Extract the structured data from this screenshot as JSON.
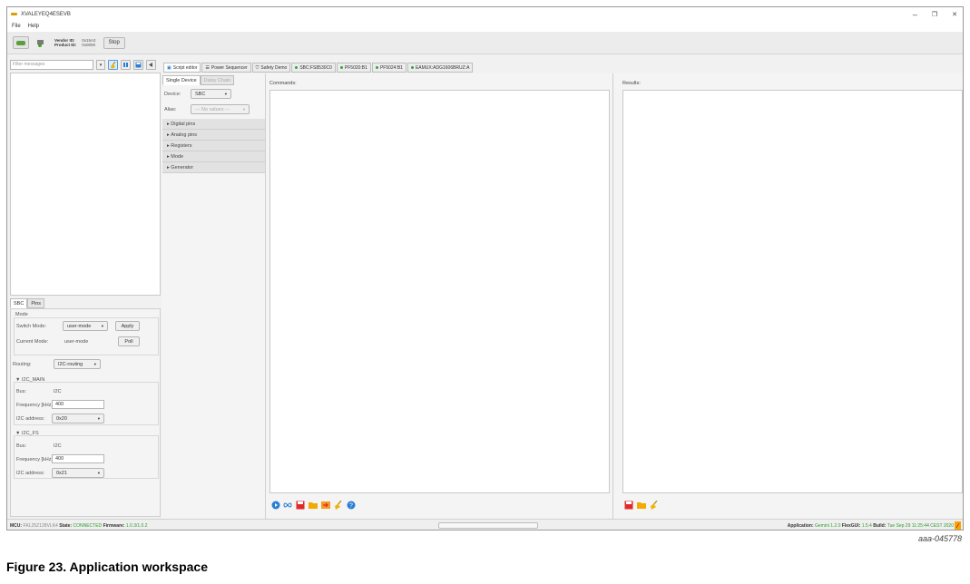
{
  "window": {
    "title": "XVALEYEQ4ESEVB",
    "controls": [
      "–",
      "❐",
      "✕"
    ]
  },
  "menu": [
    "File",
    "Help"
  ],
  "toolbar": {
    "vendor_label": "Vendor ID:",
    "vendor_value": "0x15A2",
    "product_label": "Product ID:",
    "product_value": "0x0000",
    "stop_label": "Stop"
  },
  "filter": {
    "placeholder": "Filter messages"
  },
  "top_tabs": [
    "Script editor",
    "Power Sequencer",
    "Safety Demo",
    "SBC:FS8530C0",
    "PF5020:B1",
    "PF5024:B1",
    "EAMUX:ADG1606BRUZ:A"
  ],
  "device_tabs": [
    "Single Device",
    "Daisy Chain"
  ],
  "device": {
    "label": "Device:",
    "value": "SBC",
    "alias_label": "Alias:",
    "alias_value": "--- No values ---"
  },
  "accordion": [
    "Digital pins",
    "Analog pins",
    "Registers",
    "Mode",
    "Generator"
  ],
  "bottom_tabs": [
    "SBC",
    "Pins"
  ],
  "mode": {
    "title": "Mode",
    "switch_label": "Switch Mode:",
    "switch_value": "user-mode",
    "apply": "Apply",
    "current_label": "Current Mode:",
    "current_value": "user-mode",
    "poll": "Poll"
  },
  "routing": {
    "label": "Routing:",
    "value": "I2C-routing"
  },
  "i2c_main": {
    "title": "I2C_MAIN",
    "bus_label": "Bus:",
    "bus_value": "I2C",
    "freq_label": "Frequency [kHz]:",
    "freq_value": "400",
    "addr_label": "I2C address:",
    "addr_value": "0x20"
  },
  "i2c_fs": {
    "title": "I2C_FS",
    "bus_label": "Bus:",
    "bus_value": "I2C",
    "freq_label": "Frequency [kHz]:",
    "freq_value": "400",
    "addr_label": "I2C address:",
    "addr_value": "0x21"
  },
  "commands": {
    "title": "Commands:"
  },
  "results": {
    "title": "Results:"
  },
  "status": {
    "mcu_label": "MCU:",
    "mcu_value": "FKL25Z128VLK4",
    "state_label": "State:",
    "state_value": "CONNECTED",
    "fw_label": "Firmware:",
    "fw_value": "1.0.3/1.0.2",
    "app_label": "Application:",
    "app_value": "Gemini 1.2.0",
    "flex_label": "FlexGUI:",
    "flex_value": "1.5.4",
    "build_label": "Build:",
    "build_value": "Tue Sep 29 11:25:44 CEST 2020"
  },
  "figure": {
    "id": "aaa-045778",
    "caption": "Figure 23.  Application workspace"
  }
}
